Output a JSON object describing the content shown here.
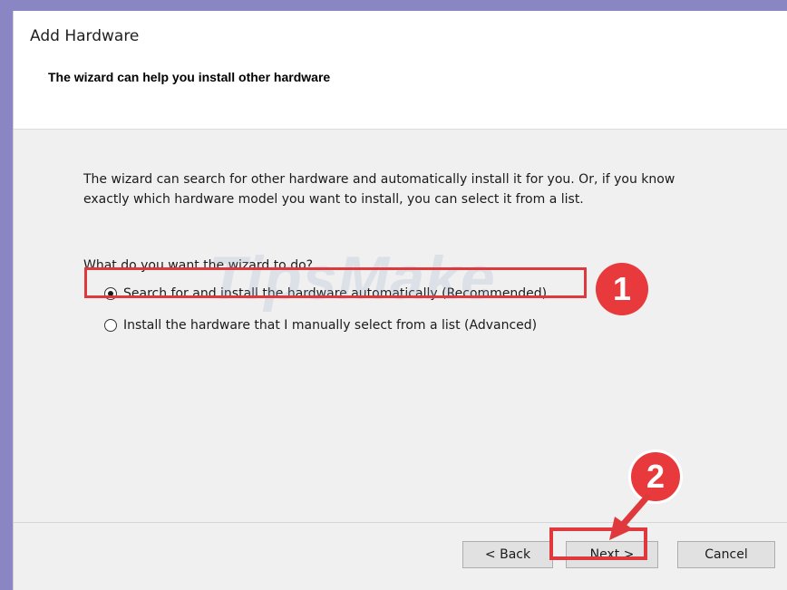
{
  "window": {
    "title": "Add Hardware",
    "subtitle": "The wizard can help you install other hardware"
  },
  "content": {
    "description": "The wizard can search for other hardware and automatically install it for you. Or, if you know exactly which hardware model you want to install, you can select it from a list.",
    "question": "What do you want the wizard to do?",
    "options": [
      {
        "label": "Search for and install the hardware automatically (Recommended)",
        "selected": true
      },
      {
        "label": "Install the hardware that I manually select from a list (Advanced)",
        "selected": false
      }
    ]
  },
  "buttons": {
    "back": "< Back",
    "next": "Next >",
    "cancel": "Cancel"
  },
  "annotations": {
    "step1": "1",
    "step2": "2",
    "highlight_color": "#e0393d"
  },
  "watermark": "TipsMake"
}
